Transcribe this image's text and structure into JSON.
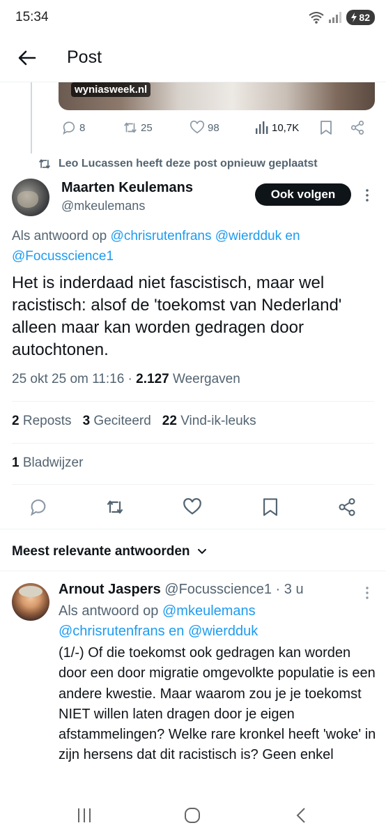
{
  "status": {
    "time": "15:34",
    "battery": "82"
  },
  "header": {
    "title": "Post"
  },
  "previous_post": {
    "domain": "wyniasweek.nl",
    "replies": "8",
    "reposts": "25",
    "likes": "98",
    "views": "10,7K"
  },
  "repost_note": "Leo Lucassen heeft deze post opnieuw geplaatst",
  "post": {
    "author_name": "Maarten Keulemans",
    "author_handle": "@mkeulemans",
    "follow_label": "Ook volgen",
    "reply_prefix": "Als antwoord op ",
    "reply_mentions_1": "@chrisrutenfrans",
    "reply_mentions_2": "@wierdduk",
    "reply_and": " en ",
    "reply_mentions_3": "@Focusscience1",
    "text": "Het is inderdaad niet fascistisch, maar wel racistisch: alsof de 'toekomst van Nederland' alleen maar kan worden gedragen door autochtonen.",
    "date": "25 okt 25 om 11:16 · ",
    "views_count": "2.127",
    "views_label": " Weergaven",
    "reposts_count": "2",
    "reposts_label": "Reposts",
    "quotes_count": "3",
    "quotes_label": "Geciteerd",
    "likes_count": "22",
    "likes_label": "Vind-ik-leuks",
    "bookmarks_count": "1",
    "bookmarks_label": "Bladwijzer"
  },
  "sort_label": "Meest relevante antwoorden",
  "reply": {
    "author_name": "Arnout Jaspers",
    "author_handle": "@Focusscience1",
    "time": " · 3 u",
    "reply_prefix": "Als antwoord op ",
    "mention_1": "@mkeulemans",
    "mention_2": "@chrisrutenfrans",
    "and": " en ",
    "mention_3": "@wierdduk",
    "text": "(1/-) Of die toekomst ook gedragen kan worden door een door migratie omgevolkte populatie is een andere kwestie. Maar waarom zou je je toekomst NIET willen laten dragen door je eigen afstammelingen? Welke rare kronkel heeft 'woke' in zijn hersens dat dit racistisch is? Geen enkel"
  }
}
